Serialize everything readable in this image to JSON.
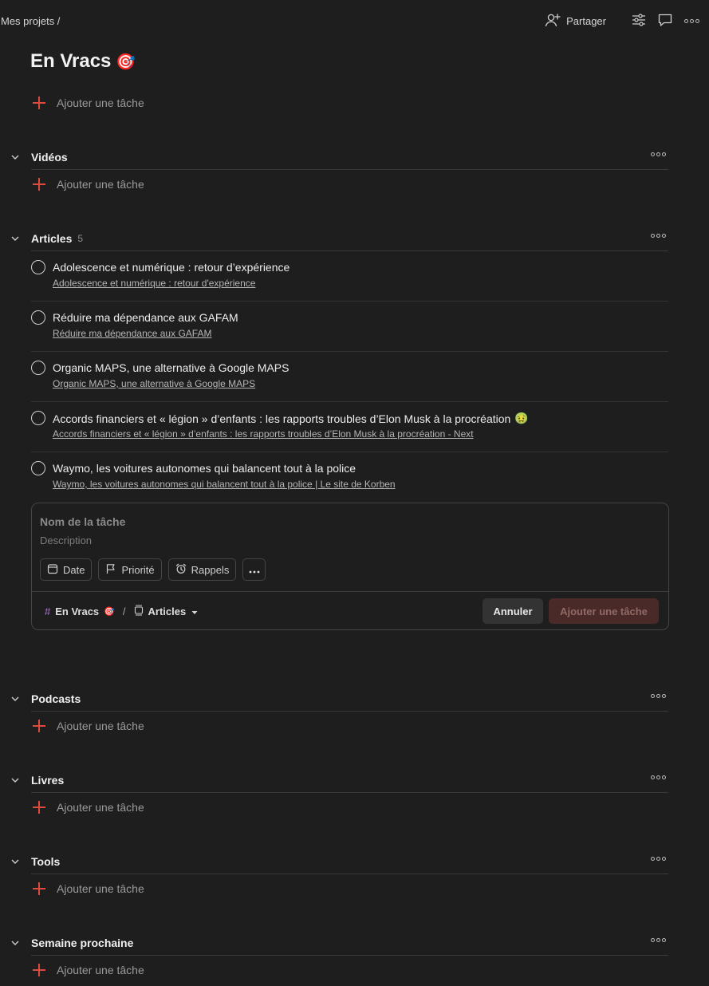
{
  "breadcrumb": "Mes projets /",
  "header": {
    "share_label": "Partager",
    "icons": [
      "add-person-icon",
      "view-settings-icon",
      "comments-icon",
      "more-icon"
    ]
  },
  "project": {
    "title": "En Vracs",
    "emoji": "🎯",
    "add_task_label": "Ajouter une tâche"
  },
  "sections": {
    "videos": {
      "name": "Vidéos",
      "add_task_label": "Ajouter une tâche"
    },
    "articles": {
      "name": "Articles",
      "count": "5",
      "tasks": [
        {
          "title": "Adolescence et numérique : retour d’expérience",
          "emoji": "",
          "link": "Adolescence et numérique : retour d'expérience"
        },
        {
          "title": "Réduire ma dépendance aux GAFAM",
          "emoji": "",
          "link": "Réduire ma dépendance aux GAFAM"
        },
        {
          "title": "Organic MAPS, une alternative à Google MAPS",
          "emoji": "",
          "link": "Organic MAPS, une alternative à Google MAPS"
        },
        {
          "title": "Accords financiers et « légion » d’enfants : les rapports troubles d’Elon Musk à la procréation",
          "emoji": "🤢",
          "link": "Accords financiers et « légion » d’enfants : les rapports troubles d’Elon Musk à la procréation - Next"
        },
        {
          "title": "Waymo, les voitures autonomes qui balancent tout à la police",
          "emoji": "",
          "link": "Waymo, les voitures autonomes qui balancent tout à la police | Le site de Korben"
        }
      ]
    },
    "podcasts": {
      "name": "Podcasts",
      "add_task_label": "Ajouter une tâche"
    },
    "livres": {
      "name": "Livres",
      "add_task_label": "Ajouter une tâche"
    },
    "tools": {
      "name": "Tools",
      "add_task_label": "Ajouter une tâche"
    },
    "semaine": {
      "name": "Semaine prochaine",
      "add_task_label": "Ajouter une tâche"
    }
  },
  "editor": {
    "name_placeholder": "Nom de la tâche",
    "description_placeholder": "Description",
    "chips": {
      "date": "Date",
      "priority": "Priorité",
      "reminders": "Rappels"
    },
    "project_name": "En Vracs",
    "project_emoji": "🎯",
    "section_name": "Articles",
    "cancel_label": "Annuler",
    "submit_label": "Ajouter une tâche"
  },
  "colors": {
    "background": "#1e1e1e",
    "accent": "#dc4c3e",
    "project_hash": "#b07ad8"
  }
}
